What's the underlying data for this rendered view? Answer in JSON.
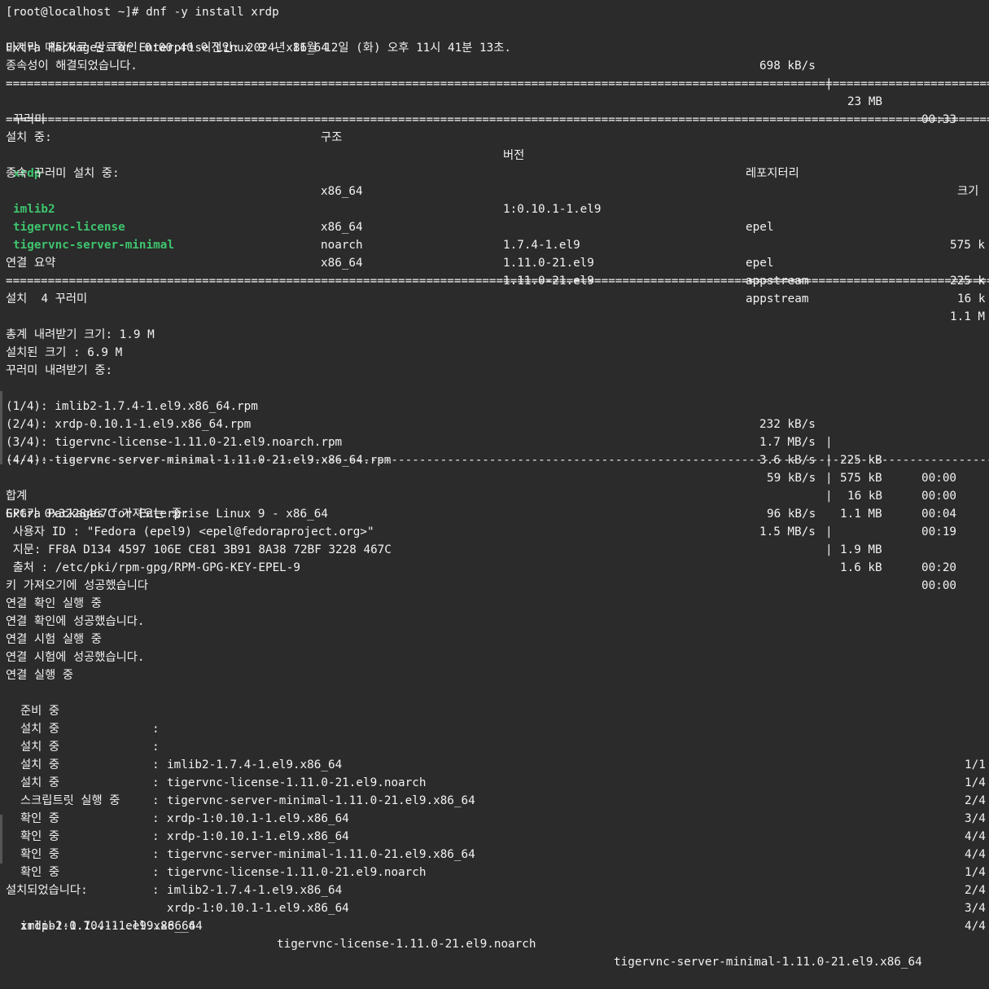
{
  "prompt": "[root@localhost ~]#",
  "command": "dnf -y install xrdp",
  "repo_line": {
    "name": "Extra Packages for Enterprise Linux 9 - x86_64",
    "speed": "698 kB/s",
    "sep": "|",
    "size": "23 MB",
    "time": "00:33"
  },
  "meta_line": "마지막 메타자료 만료확인 0:00:40 이전인: 2024년 11월 12일 (화) 오후 11시 41분 13초.",
  "deps_resolved": "종속성이 해결되었습니다.",
  "table_headers": [
    "꾸러미",
    "구조",
    "버전",
    "레포지터리",
    "크기"
  ],
  "installing_label": "설치 중:",
  "main_pkg": {
    "name": "xrdp",
    "arch": "x86_64",
    "version": "1:0.10.1-1.el9",
    "repo": "epel",
    "size": "575 k"
  },
  "deps_label": "종속 꾸러미 설치 중:",
  "dep_pkgs": [
    {
      "name": "imlib2",
      "arch": "x86_64",
      "version": "1.7.4-1.el9",
      "repo": "epel",
      "size": "225 k"
    },
    {
      "name": "tigervnc-license",
      "arch": "noarch",
      "version": "1.11.0-21.el9",
      "repo": "appstream",
      "size": "16 k"
    },
    {
      "name": "tigervnc-server-minimal",
      "arch": "x86_64",
      "version": "1.11.0-21.el9",
      "repo": "appstream",
      "size": "1.1 M"
    }
  ],
  "summary_title": "연결 요약",
  "install_count": "설치  4 꾸러미",
  "total_download": "총계 내려받기 크기: 1.9 M",
  "installed_size": "설치된 크기 : 6.9 M",
  "downloading": "꾸러미 내려받기 중:",
  "downloads": [
    {
      "file": "(1/4): imlib2-1.7.4-1.el9.x86_64.rpm",
      "speed": "232 kB/s",
      "size": "225 kB",
      "time": "00:00"
    },
    {
      "file": "(2/4): xrdp-0.10.1-1.el9.x86_64.rpm",
      "speed": "1.7 MB/s",
      "size": "575 kB",
      "time": "00:00"
    },
    {
      "file": "(3/4): tigervnc-license-1.11.0-21.el9.noarch.rpm",
      "speed": "3.6 kB/s",
      "size": "16 kB",
      "time": "00:04"
    },
    {
      "file": "(4/4): tigervnc-server-minimal-1.11.0-21.el9.x86_64.rpm",
      "speed": "59 kB/s",
      "size": "1.1 MB",
      "time": "00:19"
    }
  ],
  "total_line": {
    "label": "합계",
    "speed": "96 kB/s",
    "size": "1.9 MB",
    "time": "00:20"
  },
  "epel_line": {
    "name": "Extra Packages for Enterprise Linux 9 - x86_64",
    "speed": "1.5 MB/s",
    "size": "1.6 kB",
    "time": "00:00"
  },
  "gpg_lines": [
    "GPG키 0x3228467C 가져오는 중:",
    " 사용자 ID : \"Fedora (epel9) <epel@fedoraproject.org>\"",
    " 지문: FF8A D134 4597 106E CE81 3B91 8A38 72BF 3228 467C",
    " 출처 : /etc/pki/rpm-gpg/RPM-GPG-KEY-EPEL-9",
    "키 가져오기에 성공했습니다",
    "연결 확인 실행 중",
    "연결 확인에 성공했습니다.",
    "연결 시험 실행 중",
    "연결 시험에 성공했습니다.",
    "연결 실행 중"
  ],
  "steps": [
    {
      "label": "준비 중",
      "pkg": "",
      "count": "1/1"
    },
    {
      "label": "설치 중",
      "pkg": "imlib2-1.7.4-1.el9.x86_64",
      "count": "1/4"
    },
    {
      "label": "설치 중",
      "pkg": "tigervnc-license-1.11.0-21.el9.noarch",
      "count": "2/4"
    },
    {
      "label": "설치 중",
      "pkg": "tigervnc-server-minimal-1.11.0-21.el9.x86_64",
      "count": "3/4"
    },
    {
      "label": "설치 중",
      "pkg": "xrdp-1:0.10.1-1.el9.x86_64",
      "count": "4/4"
    },
    {
      "label": "스크립트릿 실행 중",
      "pkg": "xrdp-1:0.10.1-1.el9.x86_64",
      "count": "4/4"
    },
    {
      "label": "확인 중",
      "pkg": "tigervnc-server-minimal-1.11.0-21.el9.x86_64",
      "count": "1/4"
    },
    {
      "label": "확인 중",
      "pkg": "tigervnc-license-1.11.0-21.el9.noarch",
      "count": "2/4"
    },
    {
      "label": "확인 중",
      "pkg": "imlib2-1.7.4-1.el9.x86_64",
      "count": "3/4"
    },
    {
      "label": "확인 중",
      "pkg": "xrdp-1:0.10.1-1.el9.x86_64",
      "count": "4/4"
    }
  ],
  "installed_label": "설치되었습니다:",
  "installed": [
    "imlib2-1.7.4-1.el9.x86_64",
    "tigervnc-license-1.11.0-21.el9.noarch",
    "tigervnc-server-minimal-1.11.0-21.el9.x86_64",
    "xrdp-1:0.10.1-1.el9.x86_64"
  ],
  "colors": {
    "background": "#2b2b2b",
    "text": "#f2f2f2",
    "package": "#3ec46d"
  }
}
